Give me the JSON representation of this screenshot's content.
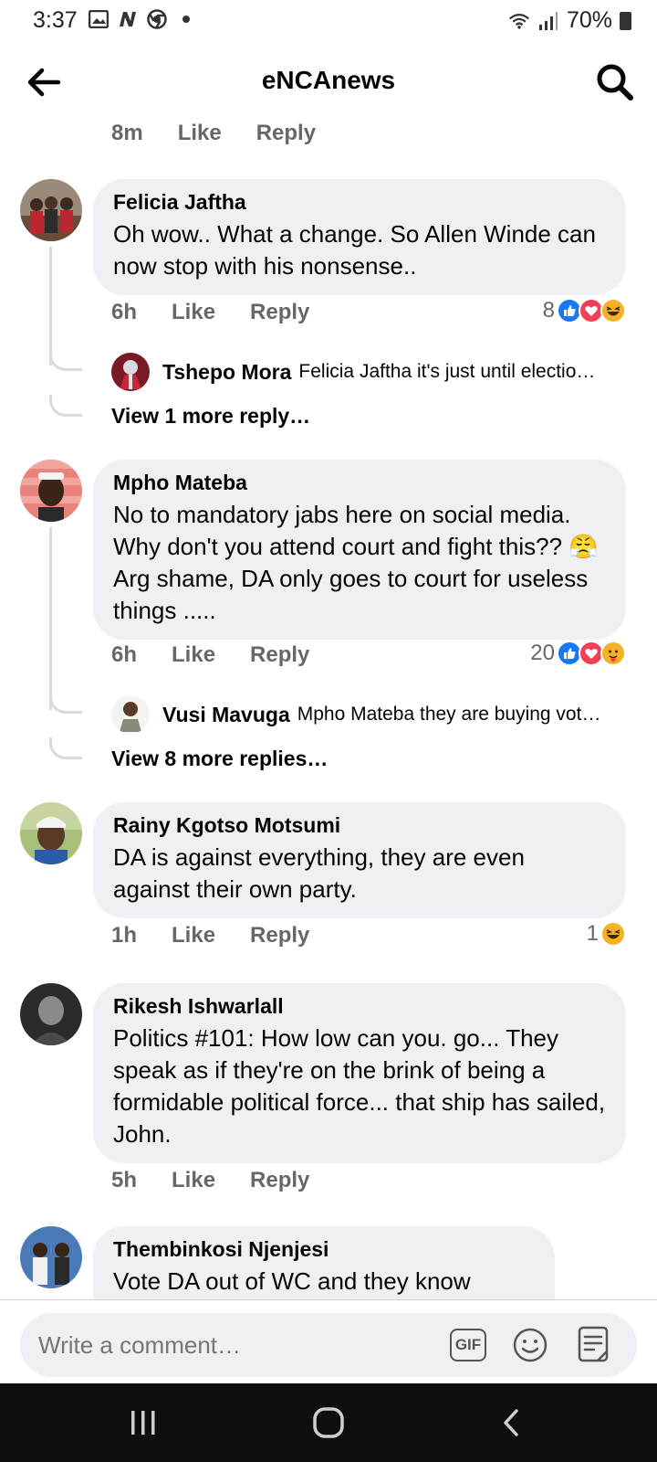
{
  "status_bar": {
    "time": "3:37",
    "battery": "70%",
    "icons": [
      "gallery-icon",
      "n-app-icon",
      "chrome-icon",
      "dot-icon",
      "wifi-icon",
      "signal-icon",
      "battery-icon"
    ]
  },
  "header": {
    "title": "eNCAnews",
    "back_icon": "arrow-left-icon",
    "search_icon": "search-icon"
  },
  "top_meta": {
    "time": "8m",
    "like": "Like",
    "reply": "Reply"
  },
  "comments": [
    {
      "author": "Felicia Jaftha",
      "text": "Oh wow.. What a change. So Allen Winde can now stop with his nonsense..",
      "time": "6h",
      "like": "Like",
      "reply": "Reply",
      "reaction_count": "8",
      "reactions": [
        "like",
        "love",
        "haha"
      ],
      "reply_preview": {
        "author": "Tshepo Mora",
        "text": "Felicia Jaftha it's just until electio…"
      },
      "view_more": "View 1 more reply…"
    },
    {
      "author": "Mpho Mateba",
      "text": "No to mandatory jabs here on social media. Why don't you attend court and fight this?? 😤 Arg shame, DA only goes to court for useless things .....",
      "time": "6h",
      "like": "Like",
      "reply": "Reply",
      "reaction_count": "20",
      "reactions": [
        "like",
        "love",
        "care"
      ],
      "reply_preview": {
        "author": "Vusi Mavuga",
        "text": "Mpho Mateba they are buying vot…"
      },
      "view_more": "View 8 more replies…"
    },
    {
      "author": "Rainy Kgotso Motsumi",
      "text": "DA is against everything, they are even against their own party.",
      "time": "1h",
      "like": "Like",
      "reply": "Reply",
      "reaction_count": "1",
      "reactions": [
        "haha"
      ]
    },
    {
      "author": "Rikesh Ishwarlall",
      "text": "Politics #101: How low can you. go... They speak as if they're on the brink of being a formidable political force... that ship has sailed, John.",
      "time": "5h",
      "like": "Like",
      "reply": "Reply"
    },
    {
      "author": "Thembinkosi Njenjesi",
      "text": "Vote DA out of WC and they know that..."
    }
  ],
  "composer": {
    "placeholder": "Write a comment…",
    "gif_label": "GIF",
    "icons": [
      "gif-icon",
      "emoji-icon",
      "sticker-icon"
    ]
  },
  "nav": {
    "icons": [
      "recent-apps-icon",
      "home-icon",
      "back-icon"
    ]
  },
  "colors": {
    "bubble": "#eff0f3",
    "meta": "#65676b",
    "like_blue": "#1877f2",
    "love_red": "#f33e58",
    "haha_yellow": "#f7b125"
  }
}
